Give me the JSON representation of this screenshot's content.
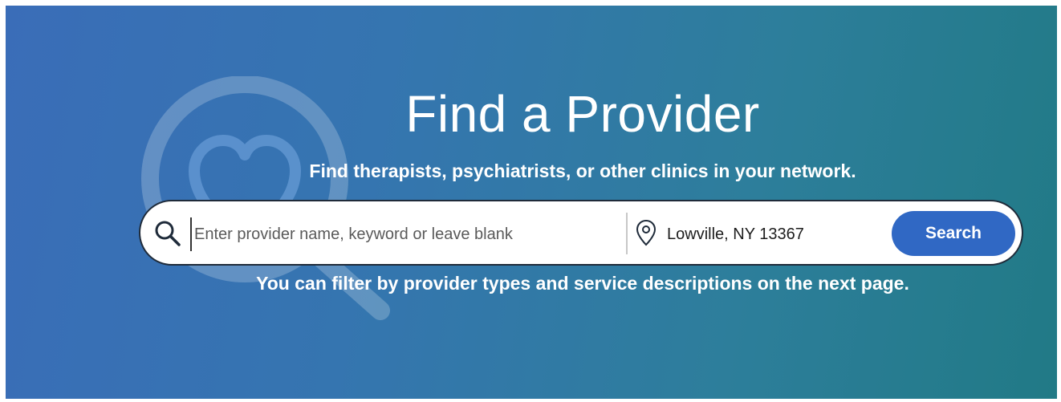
{
  "hero": {
    "title": "Find a Provider",
    "subtitle": "Find therapists, psychiatrists, or other clinics in your network.",
    "hint": "You can filter by provider types and service descriptions on the next page.",
    "background_colors": [
      "#3a6db8",
      "#217a86"
    ],
    "decoration_icon": "magnifier-heart-icon"
  },
  "search": {
    "keyword_placeholder": "Enter provider name, keyword or leave blank",
    "keyword_value": "",
    "location_value": "Lowville, NY 13367",
    "button_label": "Search",
    "button_color": "#3068c4",
    "search_icon": "search-icon",
    "location_icon": "map-pin-icon"
  }
}
